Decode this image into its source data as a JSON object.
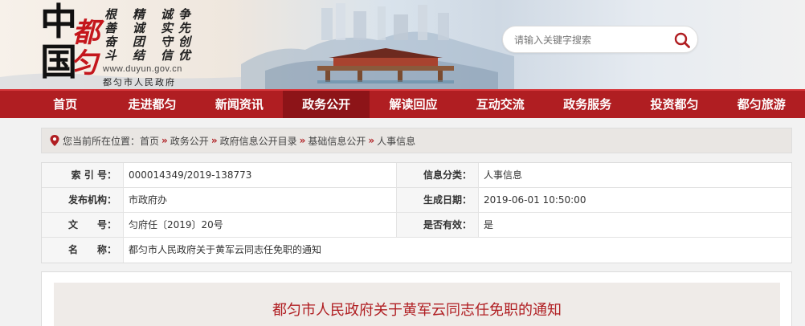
{
  "header": {
    "logo_chars": [
      "中",
      "都",
      "国",
      "匀"
    ],
    "motto_columns": [
      "根善奋斗",
      "精诚团结",
      "诚实守信",
      "争先创优"
    ],
    "site_url": "www.duyun.gov.cn",
    "site_name": "都匀市人民政府",
    "search": {
      "placeholder": "请输入关键字搜索",
      "button_icon": "magnifier-icon"
    }
  },
  "nav": {
    "items": [
      "首页",
      "走进都匀",
      "新闻资讯",
      "政务公开",
      "解读回应",
      "互动交流",
      "政务服务",
      "投资都匀",
      "都匀旅游"
    ],
    "active_index": 3
  },
  "breadcrumb": {
    "prefix": "您当前所在位置：",
    "items": [
      "首页",
      "政务公开",
      "政府信息公开目录",
      "基础信息公开",
      "人事信息"
    ],
    "separator": "»"
  },
  "info": {
    "index_label": "索 引 号：",
    "index_value": "000014349/2019-138773",
    "category_label": "信息分类：",
    "category_value": "人事信息",
    "publisher_label": "发布机构：",
    "publisher_value": "市政府办",
    "date_label": "生成日期：",
    "date_value": "2019-06-01 10:50:00",
    "docno_label": "文　　号：",
    "docno_value": "匀府任〔2019〕20号",
    "valid_label": "是否有效：",
    "valid_value": "是",
    "name_label": "名　　称：",
    "name_value": "都匀市人民政府关于黄军云同志任免职的通知"
  },
  "article": {
    "title": "都匀市人民政府关于黄军云同志任免职的通知"
  },
  "colors": {
    "brand_red": "#b01e22",
    "nav_active": "#8d1418",
    "title_red": "#b01e22"
  }
}
